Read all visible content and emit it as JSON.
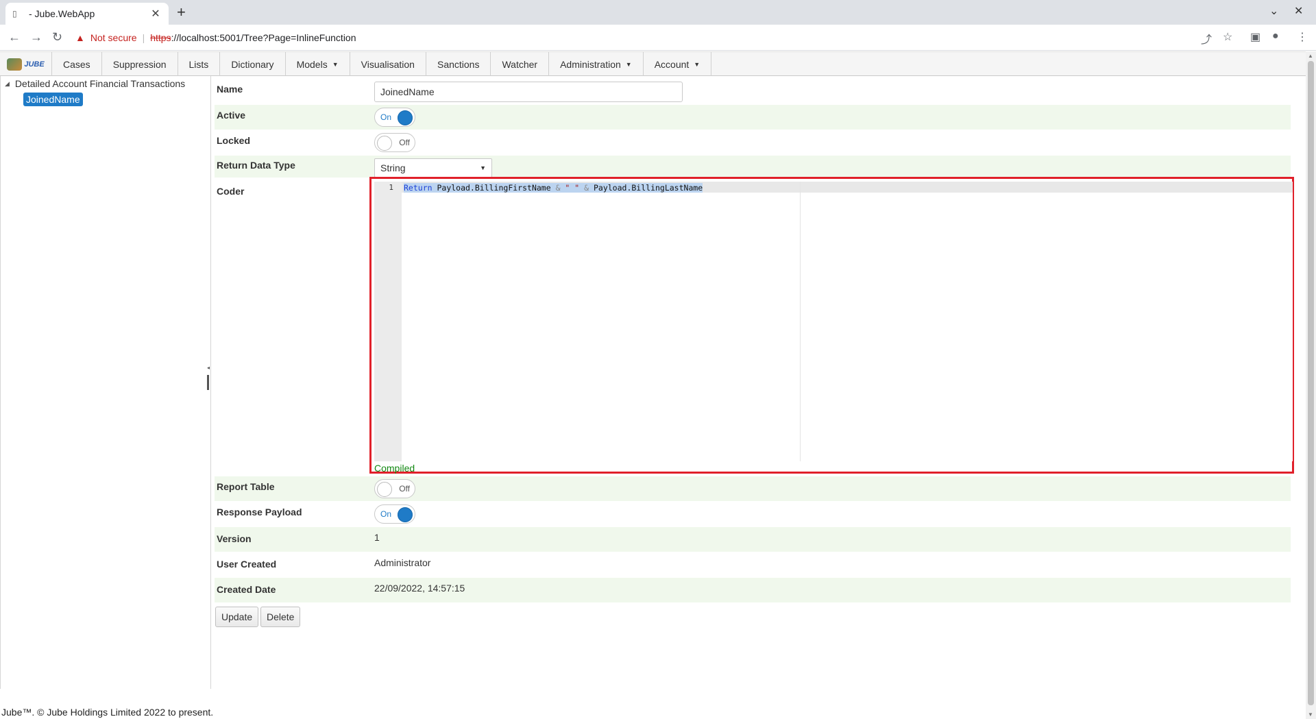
{
  "browser": {
    "tab_title": "- Jube.WebApp",
    "tab_close": "✕",
    "new_tab": "+",
    "not_secure": "Not secure",
    "url_scheme": "https",
    "url_rest": "://localhost:5001/Tree?Page=InlineFunction"
  },
  "menu": {
    "logo_text": "JUBE",
    "items": [
      {
        "label": "Cases"
      },
      {
        "label": "Suppression"
      },
      {
        "label": "Lists"
      },
      {
        "label": "Dictionary"
      },
      {
        "label": "Models",
        "dropdown": true
      },
      {
        "label": "Visualisation"
      },
      {
        "label": "Sanctions"
      },
      {
        "label": "Watcher"
      },
      {
        "label": "Administration",
        "dropdown": true
      },
      {
        "label": "Account",
        "dropdown": true
      }
    ]
  },
  "tree": {
    "root": "Detailed Account Financial Transactions",
    "child": "JoinedName"
  },
  "form": {
    "name_label": "Name",
    "name_value": "JoinedName",
    "active_label": "Active",
    "active_state": "On",
    "locked_label": "Locked",
    "locked_state": "Off",
    "return_type_label": "Return Data Type",
    "return_type_value": "String",
    "coder_label": "Coder",
    "line_number": "1",
    "code": {
      "kw": "Return",
      "part1": " Payload.BillingFirstName ",
      "amp1": "&",
      "str": " \" \" ",
      "amp2": "&",
      "part2": " Payload.BillingLastName"
    },
    "compiled_status": "Compiled",
    "report_table_label": "Report Table",
    "report_table_state": "Off",
    "response_payload_label": "Response Payload",
    "response_payload_state": "On",
    "version_label": "Version",
    "version_value": "1",
    "user_created_label": "User Created",
    "user_created_value": "Administrator",
    "created_date_label": "Created Date",
    "created_date_value": "22/09/2022, 14:57:15",
    "update_button": "Update",
    "delete_button": "Delete"
  },
  "footer": {
    "text": "Jube™. © Jube Holdings Limited 2022 to present."
  },
  "colors": {
    "accent": "#1f7bc7",
    "highlight_box": "#e0202a",
    "compiled_green": "#118811",
    "row_alt": "#f0f8ec"
  }
}
